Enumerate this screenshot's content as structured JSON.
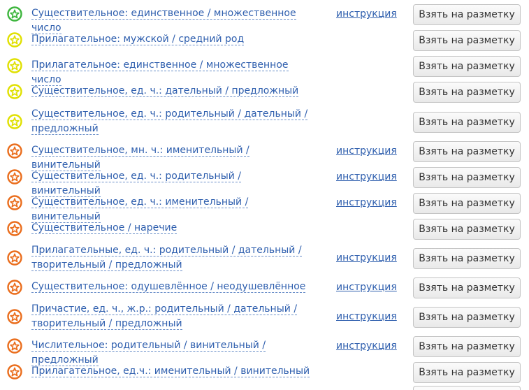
{
  "colors": {
    "green": "#3db53d",
    "yellow": "#e0e000",
    "orange": "#ea6d1c",
    "link": "#2f5fae"
  },
  "icons": {
    "status": "star-in-circle-icon"
  },
  "button_label": "Взять на разметку",
  "instruction_label": "инструкция",
  "tasks": [
    {
      "title": "Существительное: единственное / множественное число",
      "status": "green",
      "instruction": true
    },
    {
      "title": "Прилагательное: мужской / средний род",
      "status": "yellow",
      "instruction": false
    },
    {
      "title": "Прилагательное: единственное / множественное число",
      "status": "yellow",
      "instruction": false
    },
    {
      "title": "Существительное, ед. ч.: дательный / предложный",
      "status": "yellow",
      "instruction": false
    },
    {
      "title": "Существительное, ед. ч.: родительный / дательный / предложный",
      "status": "yellow",
      "instruction": false
    },
    {
      "title": "Существительное, мн. ч.: именительный / винительный",
      "status": "orange",
      "instruction": true
    },
    {
      "title": "Существительное, ед. ч.: родительный / винительный",
      "status": "orange",
      "instruction": true
    },
    {
      "title": "Существительное, ед. ч.: именительный / винительный",
      "status": "orange",
      "instruction": true
    },
    {
      "title": "Существительное / наречие",
      "status": "orange",
      "instruction": false
    },
    {
      "title": "Прилагательные, ед. ч.: родительный / дательный / творительный / предложный",
      "status": "orange",
      "instruction": true
    },
    {
      "title": "Существительное: одушевлённое / неодушевлённое",
      "status": "orange",
      "instruction": true
    },
    {
      "title": "Причастие, ед. ч., ж.р.: родительный / дательный / творительный / предложный",
      "status": "orange",
      "instruction": true
    },
    {
      "title": "Числительное: родительный / винительный / предложный",
      "status": "orange",
      "instruction": true
    },
    {
      "title": "Прилагательное, ед.ч.: именительный / винительный",
      "status": "orange",
      "instruction": false
    }
  ]
}
